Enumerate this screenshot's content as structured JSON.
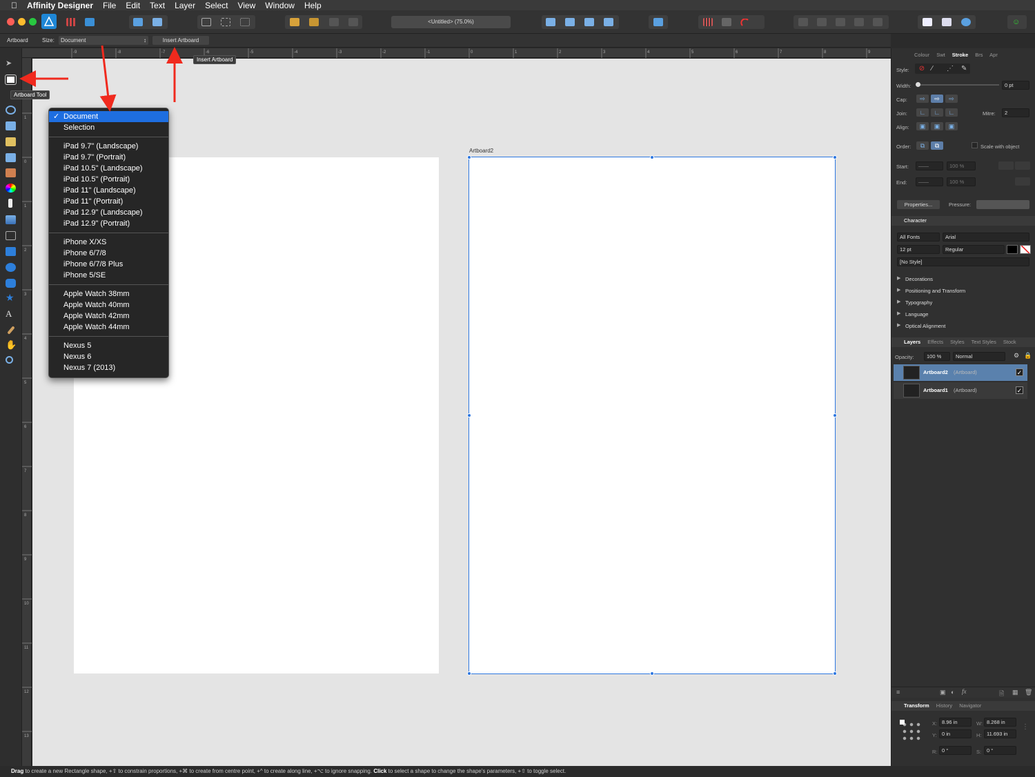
{
  "menubar": {
    "app_name": "Affinity Designer",
    "items": [
      "File",
      "Edit",
      "Text",
      "Layer",
      "Select",
      "View",
      "Window",
      "Help"
    ]
  },
  "toolbar": {
    "document_title": "<Untitled> (75.0%)"
  },
  "context_bar": {
    "tool_label": "Artboard",
    "size_label": "Size:",
    "size_value": "Document",
    "insert_button": "Insert Artboard"
  },
  "tooltips": {
    "artboard_tool": "Artboard Tool",
    "insert_artboard": "Insert Artboard"
  },
  "ruler": {
    "top_ticks": [
      "-9",
      "-8",
      "-7",
      "-6",
      "-5",
      "-4",
      "-3",
      "-2",
      "-1",
      "0",
      "1",
      "2",
      "3",
      "4",
      "5",
      "6",
      "7",
      "8",
      "9"
    ],
    "left_ticks": [
      "1",
      "0",
      "1",
      "2",
      "3",
      "4",
      "5",
      "6",
      "7",
      "8",
      "9",
      "10",
      "11",
      "12",
      "13"
    ]
  },
  "dropdown": {
    "groups": [
      [
        "Document",
        "Selection"
      ],
      [
        "iPad 9.7\" (Landscape)",
        "iPad 9.7\" (Portrait)",
        "iPad 10.5\" (Landscape)",
        "iPad 10.5\" (Portrait)",
        "iPad 11\" (Landscape)",
        "iPad 11\" (Portrait)",
        "iPad 12.9\" (Landscape)",
        "iPad 12.9\" (Portrait)"
      ],
      [
        "iPhone X/XS",
        "iPhone 6/7/8",
        "iPhone 6/7/8 Plus",
        "iPhone 5/SE"
      ],
      [
        "Apple Watch 38mm",
        "Apple Watch 40mm",
        "Apple Watch 42mm",
        "Apple Watch 44mm"
      ],
      [
        "Nexus 5",
        "Nexus 6",
        "Nexus 7 (2013)"
      ]
    ],
    "selected": "Document",
    "check": "✓"
  },
  "canvas": {
    "artboard2_label": "Artboard2"
  },
  "right_panel": {
    "top_tabs": [
      "Colour",
      "Swt",
      "Stroke",
      "Brs",
      "Apr"
    ],
    "active_top_tab": "Stroke",
    "stroke": {
      "style_label": "Style:",
      "width_label": "Width:",
      "width_value": "0 pt",
      "cap_label": "Cap:",
      "join_label": "Join:",
      "mitre_label": "Mitre:",
      "mitre_value": "2",
      "align_label": "Align:",
      "order_label": "Order:",
      "scale_label": "Scale with object",
      "start_label": "Start:",
      "end_label": "End:",
      "start_pct": "100 %",
      "end_pct": "100 %",
      "properties_button": "Properties...",
      "pressure_label": "Pressure:"
    },
    "character": {
      "title": "Character",
      "font_collection": "All Fonts",
      "font_name": "Arial",
      "font_size": "12 pt",
      "font_style": "Regular",
      "para_style": "[No Style]",
      "sections": [
        "Decorations",
        "Positioning and Transform",
        "Typography",
        "Language",
        "Optical Alignment"
      ]
    },
    "layers": {
      "tabs": [
        "Layers",
        "Effects",
        "Styles",
        "Text Styles",
        "Stock"
      ],
      "opacity_label": "Opacity:",
      "opacity_value": "100 %",
      "blend_mode": "Normal",
      "items": [
        {
          "name": "Artboard2",
          "type": "(Artboard)",
          "selected": true
        },
        {
          "name": "Artboard1",
          "type": "(Artboard)",
          "selected": false
        }
      ]
    },
    "transform": {
      "tabs": [
        "Transform",
        "History",
        "Navigator"
      ],
      "x_label": "X:",
      "x_value": "8.96 in",
      "y_label": "Y:",
      "y_value": "0 in",
      "w_label": "W:",
      "w_value": "8.268 in",
      "h_label": "H:",
      "h_value": "11.693 in",
      "r_label": "R:",
      "r_value": "0 °",
      "s_label": "S:",
      "s_value": "0 °"
    }
  },
  "status": {
    "text_parts": [
      {
        "b": "Drag",
        "t": " to create a new Rectangle shape, +⇧ to constrain proportions, +⌘ to create from centre point, +^ to create along line, +⌥ to ignore snapping. "
      },
      {
        "b": "Click",
        "t": " to select a shape to change the shape's parameters, +⇧ to toggle select."
      }
    ]
  },
  "colors": {
    "accent": "#1e6ee0",
    "annotation_red": "#f02a1e",
    "selection_blue": "#2d77e0"
  }
}
